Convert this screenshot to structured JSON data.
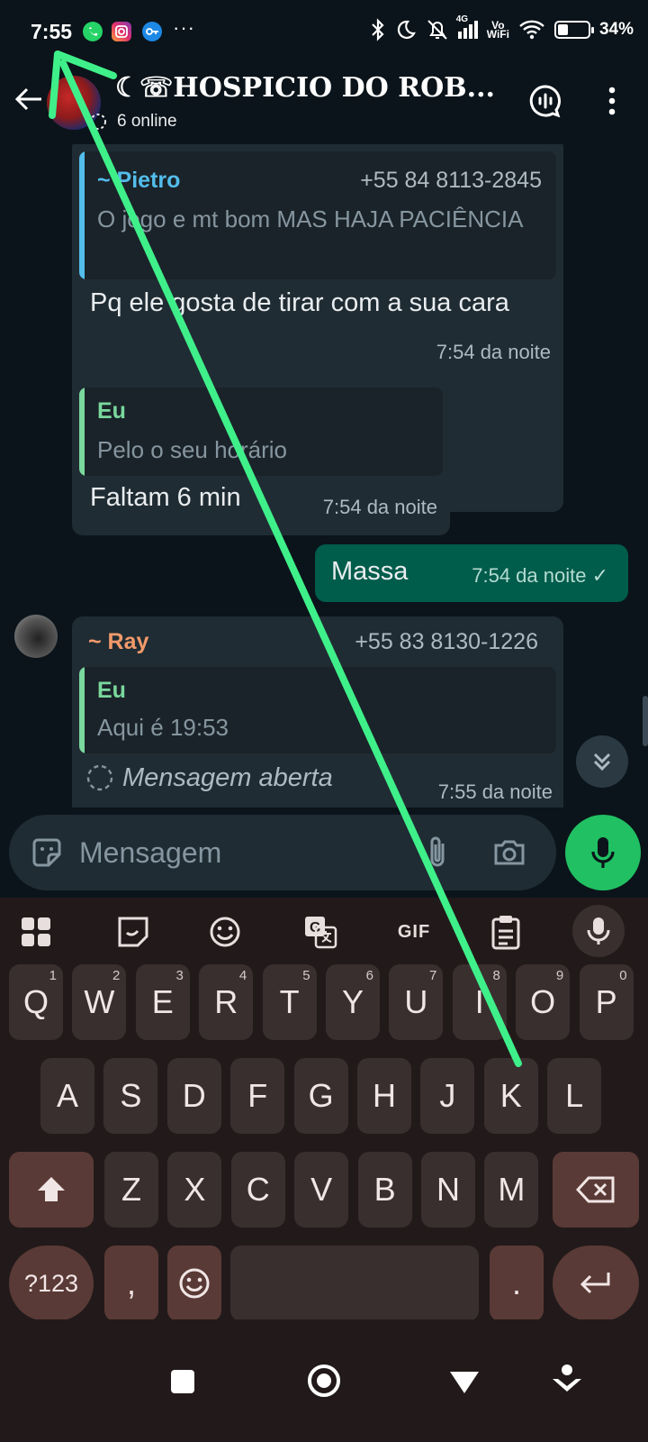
{
  "status_bar": {
    "time": "7:55",
    "icons": [
      "whatsapp-icon",
      "instagram-icon",
      "vpn-key-icon",
      "more-dots-icon",
      "bluetooth-icon",
      "moon-icon",
      "bell-off-icon",
      "signal-4g-icon",
      "vowifi-icon",
      "wifi-icon",
      "battery-icon"
    ],
    "dots": "···",
    "tag_4g": "4G",
    "tag_vo": "Vo",
    "tag_wifi": "WiFi",
    "battery_level": 0.34,
    "battery_text": "34%"
  },
  "header": {
    "title": "☾☏HOSPICIO DO ROB...",
    "subtitle": "6 online"
  },
  "messages": [
    {
      "quote_author": "~ Pietro",
      "quote_phone": "+55 84 8113-2845",
      "quote_text": "O jogo e mt bom MAS HAJA PACIÊNCIA",
      "text": "Pq ele gosta de tirar com a sua cara",
      "time": "7:54 da noite"
    },
    {
      "quote_author": "Eu",
      "quote_text": "Pelo o seu horário",
      "text": "Faltam 6 min",
      "time": "7:54 da noite"
    },
    {
      "text": "Massa",
      "time": "7:54 da noite ✓"
    },
    {
      "sender": "~ Ray",
      "sender_phone": "+55 83 8130-1226",
      "quote_author": "Eu",
      "quote_text": "Aqui é 19:53",
      "text": "Mensagem aberta",
      "time": "7:55 da noite"
    }
  ],
  "input": {
    "placeholder": "Mensagem"
  },
  "keyboard": {
    "toolbar": [
      "apps-grid-icon",
      "sticker-icon",
      "emoji-icon",
      "translate-icon",
      "gif-button",
      "clipboard-icon",
      "voice-input-icon"
    ],
    "gif_label": "GIF",
    "row1": [
      {
        "k": "Q",
        "h": "1"
      },
      {
        "k": "W",
        "h": "2"
      },
      {
        "k": "E",
        "h": "3"
      },
      {
        "k": "R",
        "h": "4"
      },
      {
        "k": "T",
        "h": "5"
      },
      {
        "k": "Y",
        "h": "6"
      },
      {
        "k": "U",
        "h": "7"
      },
      {
        "k": "I",
        "h": "8"
      },
      {
        "k": "O",
        "h": "9"
      },
      {
        "k": "P",
        "h": "0"
      }
    ],
    "row2": [
      "A",
      "S",
      "D",
      "F",
      "G",
      "H",
      "J",
      "K",
      "L"
    ],
    "row3": [
      "Z",
      "X",
      "C",
      "V",
      "B",
      "N",
      "M"
    ],
    "sym_label": "?123",
    "comma": ",",
    "period": "."
  },
  "colors": {
    "background": "#0b141a",
    "incoming_bubble": "#202c33",
    "outgoing_bubble": "#005c4b",
    "pietro_name": "#53bdeb",
    "eu_name": "#7ad89d",
    "ray_name": "#f29a6b",
    "accent_green": "#21c063",
    "annotation_arrow": "#3ff08a"
  }
}
